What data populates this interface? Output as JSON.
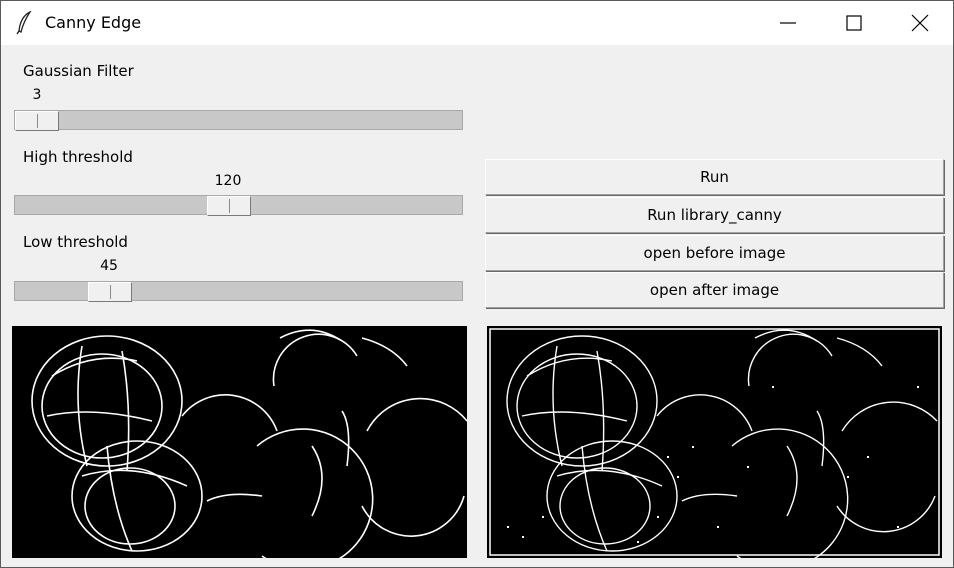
{
  "window": {
    "title": "Canny Edge"
  },
  "controls": [
    {
      "label": "Gaussian Filter",
      "value": "3",
      "level": 0.0
    },
    {
      "label": "High threshold",
      "value": "120",
      "level": 0.47
    },
    {
      "label": "Low threshold",
      "value": "45",
      "level": 0.18
    }
  ],
  "buttons": [
    "Run",
    "Run library_canny",
    "open before image",
    "open after image"
  ],
  "icons": {
    "app": "feather-icon",
    "minimize": "minimize-icon",
    "maximize": "maximize-icon",
    "close": "close-icon"
  }
}
